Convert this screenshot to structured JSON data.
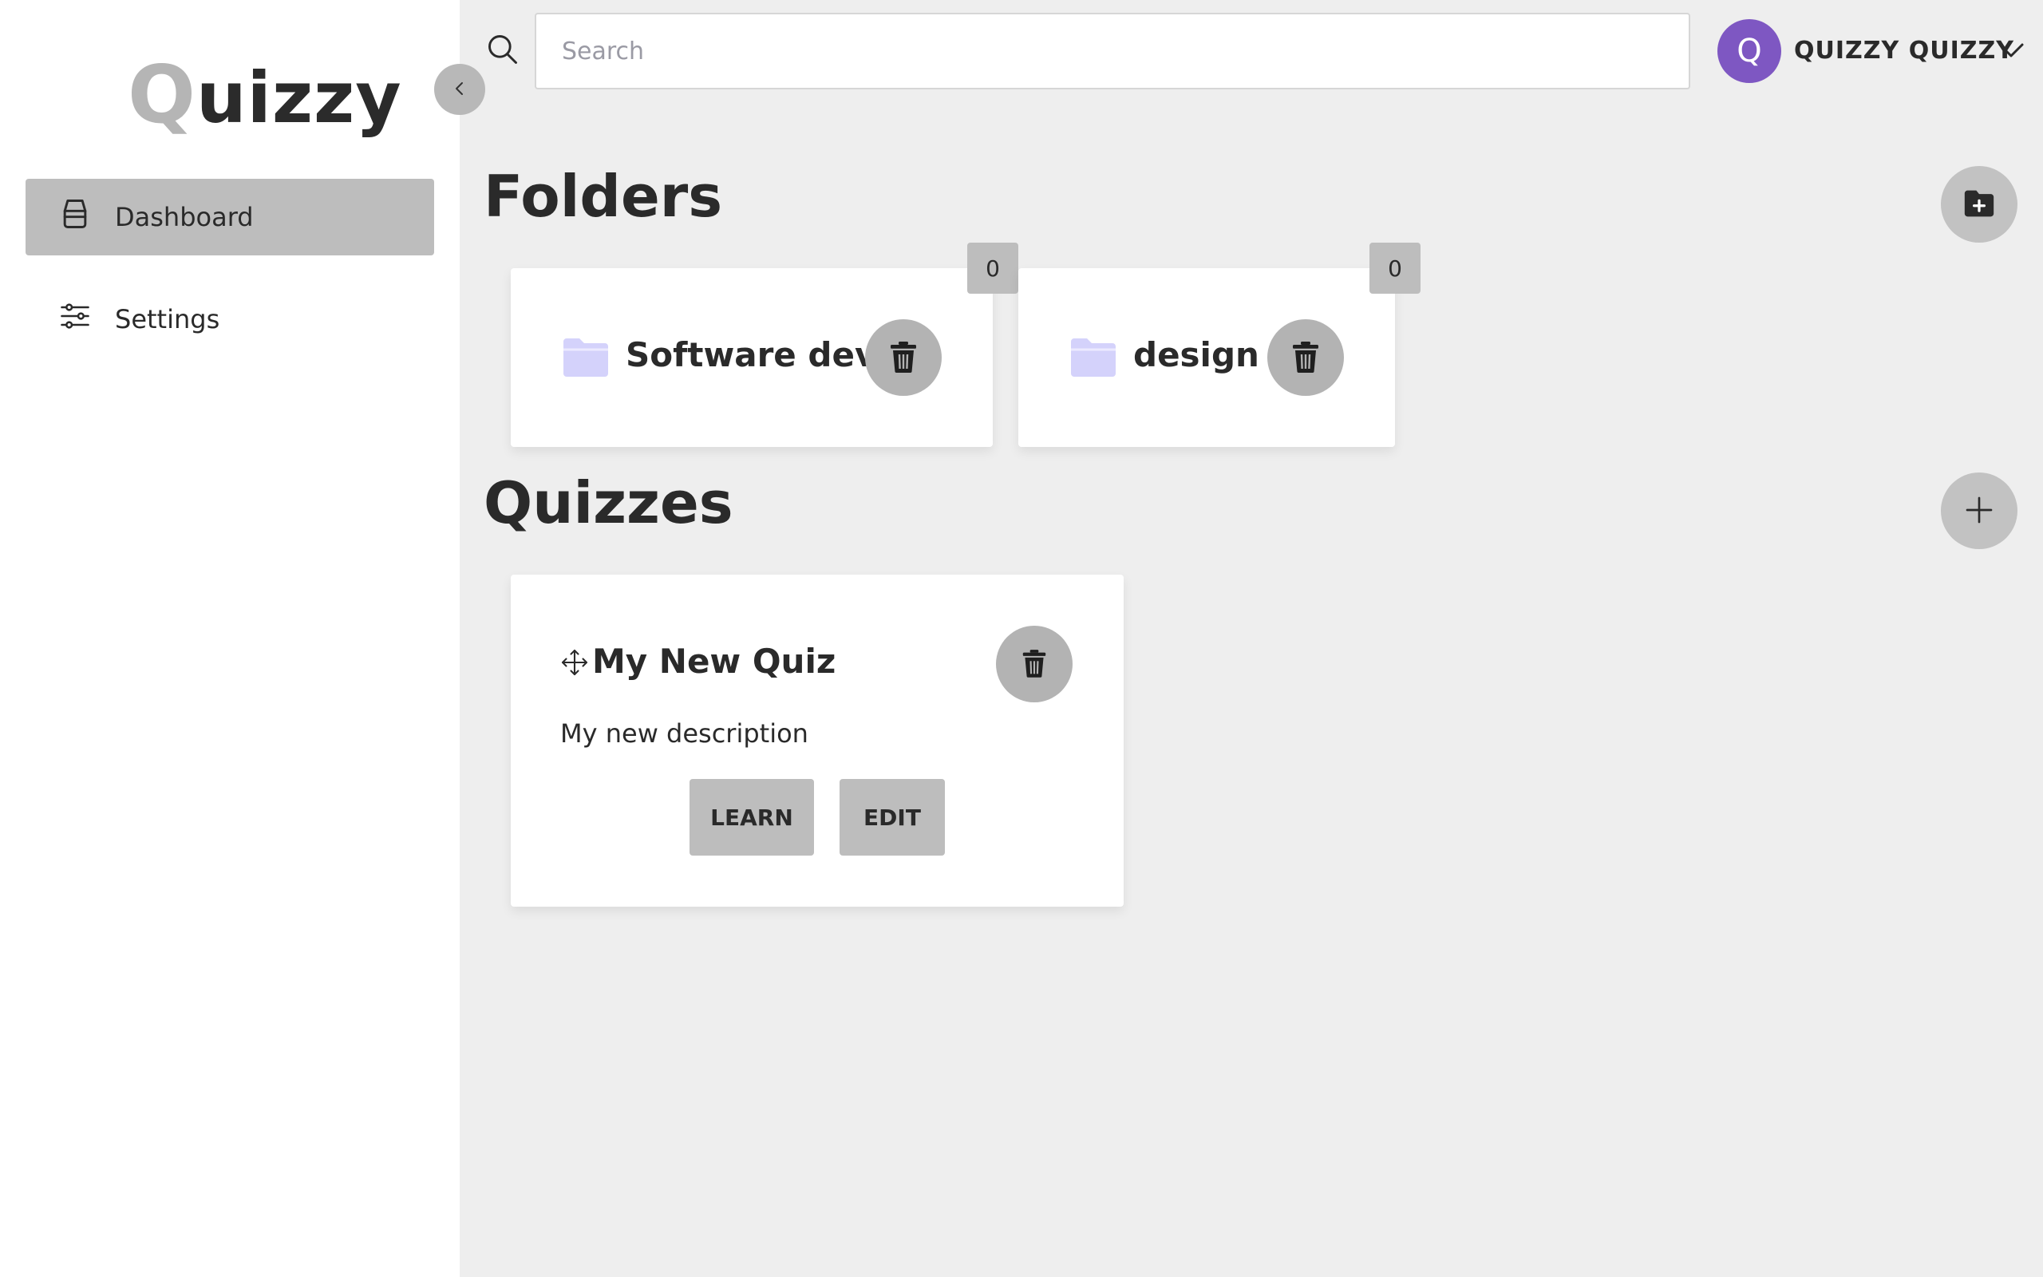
{
  "app": {
    "logo_first": "Q",
    "logo_rest": "uizzy"
  },
  "sidebar": {
    "items": [
      {
        "label": "Dashboard",
        "icon": "inbox-icon",
        "active": true
      },
      {
        "label": "Settings",
        "icon": "sliders-icon",
        "active": false
      }
    ]
  },
  "search": {
    "placeholder": "Search",
    "value": ""
  },
  "user": {
    "initial": "Q",
    "name": "QUIZZY QUIZZY",
    "avatar_color": "#7e57c2"
  },
  "folders": {
    "title": "Folders",
    "items": [
      {
        "name": "Software dev",
        "count": "0"
      },
      {
        "name": "design",
        "count": "0"
      }
    ]
  },
  "quizzes": {
    "title": "Quizzes",
    "items": [
      {
        "title": "My New Quiz",
        "description": "My new description",
        "learn_label": "LEARN",
        "edit_label": "EDIT"
      }
    ]
  },
  "colors": {
    "sidebar_bg": "#ffffff",
    "main_bg": "#eeeeee",
    "active_nav": "#bdbdbd",
    "folder_icon": "#d4d2fb"
  }
}
